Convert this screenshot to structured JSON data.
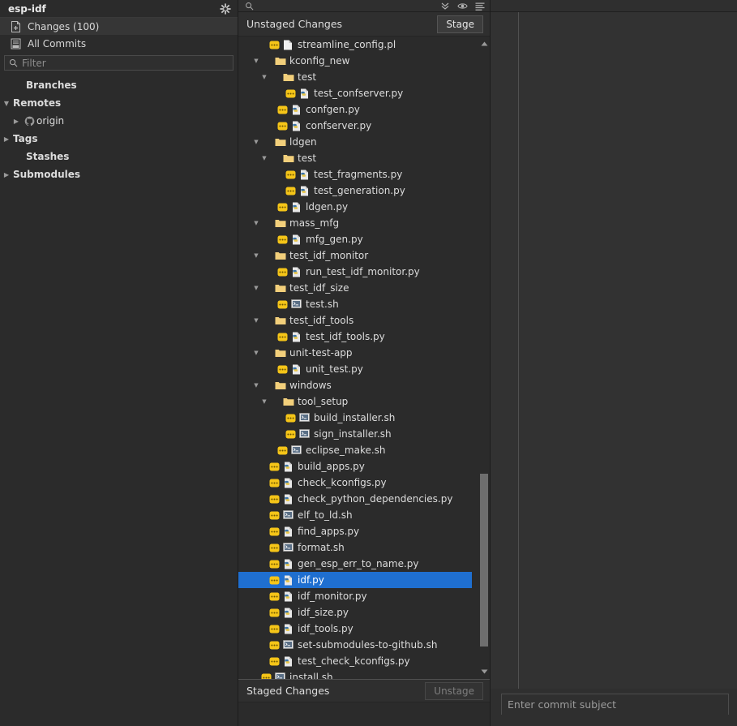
{
  "sidebar": {
    "repo_name": "esp-idf",
    "gear_icon": "gear-icon",
    "nav": [
      {
        "label": "Changes (100)",
        "icon": "changes-page-icon",
        "active": true
      },
      {
        "label": "All Commits",
        "icon": "commits-list-icon",
        "active": false
      }
    ],
    "filter": {
      "placeholder": "Filter",
      "value": "",
      "icon": "search-icon"
    },
    "tree": [
      {
        "label": "Branches",
        "twisty": "",
        "indent": 16,
        "icon": ""
      },
      {
        "label": "Remotes",
        "twisty": "down",
        "indent": 16,
        "icon": ""
      },
      {
        "label": "origin",
        "twisty": "right",
        "indent": 32,
        "icon": "github-icon"
      },
      {
        "label": "Tags",
        "twisty": "right",
        "indent": 16,
        "icon": ""
      },
      {
        "label": "Stashes",
        "twisty": "",
        "indent": 16,
        "icon": ""
      },
      {
        "label": "Submodules",
        "twisty": "right",
        "indent": 16,
        "icon": ""
      }
    ]
  },
  "middle": {
    "search_icon": "search-icon",
    "toolbar_icons": [
      "collapse-all-icon",
      "eye-icon",
      "menu-icon"
    ],
    "unstaged": {
      "title": "Unstaged Changes",
      "action_label": "Stage",
      "action_enabled": true
    },
    "staged": {
      "title": "Staged Changes",
      "action_label": "Unstage",
      "action_enabled": false
    },
    "scrollbar": {
      "up_arrow": "chevron-up-icon",
      "down_arrow": "chevron-down-icon",
      "thumb_top_pct": 68,
      "thumb_height_pct": 27
    },
    "files": [
      {
        "name": "streamline_config.pl",
        "indent": 2,
        "twisty": "",
        "badge": true,
        "icon": "file-generic-icon"
      },
      {
        "name": "kconfig_new",
        "indent": 1,
        "twisty": "down",
        "badge": false,
        "icon": "folder-icon"
      },
      {
        "name": "test",
        "indent": 2,
        "twisty": "down",
        "badge": false,
        "icon": "folder-icon"
      },
      {
        "name": "test_confserver.py",
        "indent": 4,
        "twisty": "",
        "badge": true,
        "icon": "file-python-icon"
      },
      {
        "name": "confgen.py",
        "indent": 3,
        "twisty": "",
        "badge": true,
        "icon": "file-python-icon"
      },
      {
        "name": "confserver.py",
        "indent": 3,
        "twisty": "",
        "badge": true,
        "icon": "file-python-icon"
      },
      {
        "name": "ldgen",
        "indent": 1,
        "twisty": "down",
        "badge": false,
        "icon": "folder-icon"
      },
      {
        "name": "test",
        "indent": 2,
        "twisty": "down",
        "badge": false,
        "icon": "folder-icon"
      },
      {
        "name": "test_fragments.py",
        "indent": 4,
        "twisty": "",
        "badge": true,
        "icon": "file-python-icon"
      },
      {
        "name": "test_generation.py",
        "indent": 4,
        "twisty": "",
        "badge": true,
        "icon": "file-python-icon"
      },
      {
        "name": "ldgen.py",
        "indent": 3,
        "twisty": "",
        "badge": true,
        "icon": "file-python-icon"
      },
      {
        "name": "mass_mfg",
        "indent": 1,
        "twisty": "down",
        "badge": false,
        "icon": "folder-icon"
      },
      {
        "name": "mfg_gen.py",
        "indent": 3,
        "twisty": "",
        "badge": true,
        "icon": "file-python-icon"
      },
      {
        "name": "test_idf_monitor",
        "indent": 1,
        "twisty": "down",
        "badge": false,
        "icon": "folder-icon"
      },
      {
        "name": "run_test_idf_monitor.py",
        "indent": 3,
        "twisty": "",
        "badge": true,
        "icon": "file-python-icon"
      },
      {
        "name": "test_idf_size",
        "indent": 1,
        "twisty": "down",
        "badge": false,
        "icon": "folder-icon"
      },
      {
        "name": "test.sh",
        "indent": 3,
        "twisty": "",
        "badge": true,
        "icon": "file-shell-icon"
      },
      {
        "name": "test_idf_tools",
        "indent": 1,
        "twisty": "down",
        "badge": false,
        "icon": "folder-icon"
      },
      {
        "name": "test_idf_tools.py",
        "indent": 3,
        "twisty": "",
        "badge": true,
        "icon": "file-python-icon"
      },
      {
        "name": "unit-test-app",
        "indent": 1,
        "twisty": "down",
        "badge": false,
        "icon": "folder-icon"
      },
      {
        "name": "unit_test.py",
        "indent": 3,
        "twisty": "",
        "badge": true,
        "icon": "file-python-icon"
      },
      {
        "name": "windows",
        "indent": 1,
        "twisty": "down",
        "badge": false,
        "icon": "folder-icon"
      },
      {
        "name": "tool_setup",
        "indent": 2,
        "twisty": "down",
        "badge": false,
        "icon": "folder-icon"
      },
      {
        "name": "build_installer.sh",
        "indent": 4,
        "twisty": "",
        "badge": true,
        "icon": "file-shell-icon"
      },
      {
        "name": "sign_installer.sh",
        "indent": 4,
        "twisty": "",
        "badge": true,
        "icon": "file-shell-icon"
      },
      {
        "name": "eclipse_make.sh",
        "indent": 3,
        "twisty": "",
        "badge": true,
        "icon": "file-shell-icon"
      },
      {
        "name": "build_apps.py",
        "indent": 2,
        "twisty": "",
        "badge": true,
        "icon": "file-python-icon"
      },
      {
        "name": "check_kconfigs.py",
        "indent": 2,
        "twisty": "",
        "badge": true,
        "icon": "file-python-icon"
      },
      {
        "name": "check_python_dependencies.py",
        "indent": 2,
        "twisty": "",
        "badge": true,
        "icon": "file-python-icon"
      },
      {
        "name": "elf_to_ld.sh",
        "indent": 2,
        "twisty": "",
        "badge": true,
        "icon": "file-shell-icon"
      },
      {
        "name": "find_apps.py",
        "indent": 2,
        "twisty": "",
        "badge": true,
        "icon": "file-python-icon"
      },
      {
        "name": "format.sh",
        "indent": 2,
        "twisty": "",
        "badge": true,
        "icon": "file-shell-icon"
      },
      {
        "name": "gen_esp_err_to_name.py",
        "indent": 2,
        "twisty": "",
        "badge": true,
        "icon": "file-python-icon"
      },
      {
        "name": "idf.py",
        "indent": 2,
        "twisty": "",
        "badge": true,
        "icon": "file-python-icon",
        "selected": true
      },
      {
        "name": "idf_monitor.py",
        "indent": 2,
        "twisty": "",
        "badge": true,
        "icon": "file-python-icon"
      },
      {
        "name": "idf_size.py",
        "indent": 2,
        "twisty": "",
        "badge": true,
        "icon": "file-python-icon"
      },
      {
        "name": "idf_tools.py",
        "indent": 2,
        "twisty": "",
        "badge": true,
        "icon": "file-python-icon"
      },
      {
        "name": "set-submodules-to-github.sh",
        "indent": 2,
        "twisty": "",
        "badge": true,
        "icon": "file-shell-icon"
      },
      {
        "name": "test_check_kconfigs.py",
        "indent": 2,
        "twisty": "",
        "badge": true,
        "icon": "file-python-icon"
      },
      {
        "name": "install.sh",
        "indent": 1,
        "twisty": "",
        "badge": true,
        "icon": "file-shell-icon"
      }
    ]
  },
  "right": {
    "commit_subject": {
      "placeholder": "Enter commit subject",
      "value": ""
    }
  },
  "colors": {
    "selection": "#1f6fd0",
    "badge": "#f5c518",
    "folder": "#f2cf7b",
    "background": "#2b2b2b",
    "panel": "#2f2f2f"
  }
}
